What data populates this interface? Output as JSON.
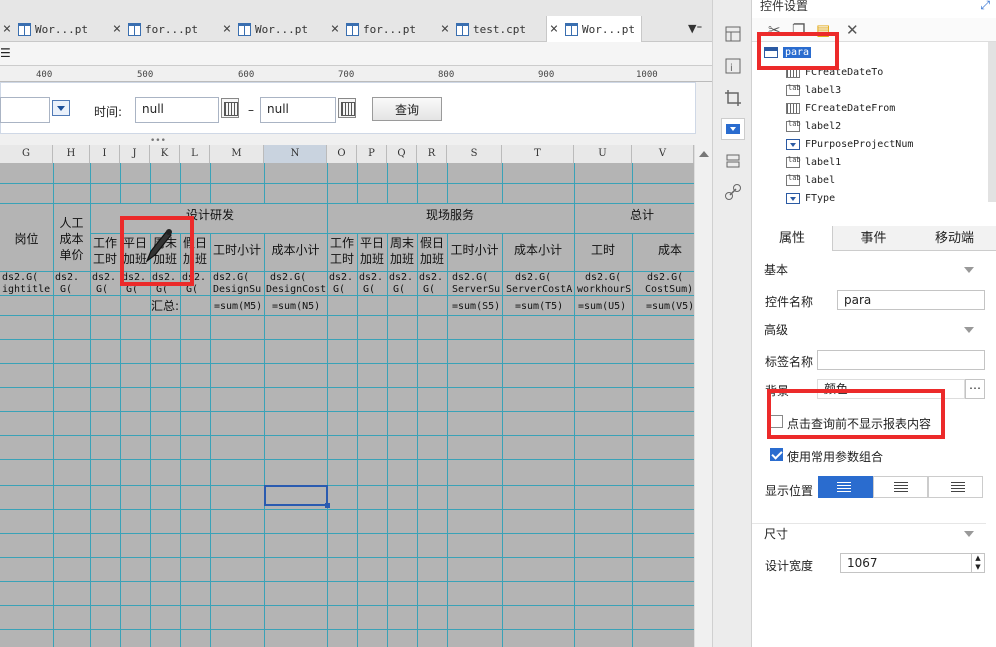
{
  "tabs": [
    {
      "label": "Wor...pt",
      "active": false
    },
    {
      "label": "for...pt",
      "active": false
    },
    {
      "label": "Wor...pt",
      "active": false
    },
    {
      "label": "for...pt",
      "active": false
    },
    {
      "label": "test.cpt",
      "active": false
    },
    {
      "label": "Wor...pt",
      "active": true
    }
  ],
  "ruler": {
    "marks": [
      "400",
      "500",
      "600",
      "700",
      "800",
      "900",
      "1000"
    ]
  },
  "params": {
    "time_label": "时间:",
    "date_from": "null",
    "date_to": "null",
    "dash": "–",
    "query_label": "查询"
  },
  "grid": {
    "columns": [
      "G",
      "H",
      "I",
      "J",
      "K",
      "L",
      "M",
      "N",
      "O",
      "P",
      "Q",
      "R",
      "S",
      "T",
      "U",
      "V"
    ],
    "selected_column": "N",
    "header_groups": {
      "design": "设计研发",
      "field": "现场服务",
      "total": "总计"
    },
    "headers": {
      "post": "岗位",
      "labor_cost": "人工\n成本\n单价",
      "work_hours": "工作\n工时",
      "weekday_ot": "平日\n加班",
      "weekend_ot": "周末\n加班",
      "holiday_ot": "假日\n加班",
      "hours_subtotal": "工时小计",
      "cost_subtotal": "成本小计",
      "hours": "工时",
      "cost": "成本"
    },
    "data_row": [
      "ds2.G(",
      "ds2.",
      "ds2.",
      "ds2.",
      "ds2.",
      "ds2.",
      "ds2.G(",
      "ds2.G(",
      "ds2.",
      "ds2.",
      "ds2.",
      "ds2.",
      "ds2.G(",
      "ds2.G(",
      "ds2.G(",
      "ds2.G("
    ],
    "data_row2": [
      "ightitle",
      "G(",
      "G(",
      "G(",
      "G(",
      "G(",
      "DesignSu",
      "DesignCost",
      "G(",
      "G(",
      "G(",
      "G(",
      "ServerSu",
      "ServerCostA",
      "workhourS",
      "CostSum)"
    ],
    "sum_label": "汇总:",
    "sums": {
      "M": "=sum(M5)",
      "N": "=sum(N5)",
      "S": "=sum(S5)",
      "T": "=sum(T5)",
      "U": "=sum(U5)",
      "V": "=sum(V5)"
    }
  },
  "panel": {
    "title": "控件设置",
    "tree": [
      {
        "label": "para",
        "icon": "form",
        "selected": true
      },
      {
        "label": "FCreateDateTo",
        "icon": "date"
      },
      {
        "label": "label3",
        "icon": "lab"
      },
      {
        "label": "FCreateDateFrom",
        "icon": "date"
      },
      {
        "label": "label2",
        "icon": "lab"
      },
      {
        "label": "FPurposeProjectNum",
        "icon": "combo"
      },
      {
        "label": "label1",
        "icon": "lab"
      },
      {
        "label": "label",
        "icon": "lab"
      },
      {
        "label": "FType",
        "icon": "combo"
      }
    ],
    "prop_tabs": [
      "属性",
      "事件",
      "移动端"
    ],
    "sections": {
      "basic": "基本",
      "advanced": "高级",
      "size": "尺寸"
    },
    "widget_name_label": "控件名称",
    "widget_name_value": "para",
    "tag_name_label": "标签名称",
    "tag_name_value": "",
    "background_label": "背景",
    "background_value": "颜色",
    "hide_before_query": "点击查询前不显示报表内容",
    "use_common_params": "使用常用参数组合",
    "display_position_label": "显示位置",
    "design_width_label": "设计宽度",
    "design_width_value": "1067"
  }
}
